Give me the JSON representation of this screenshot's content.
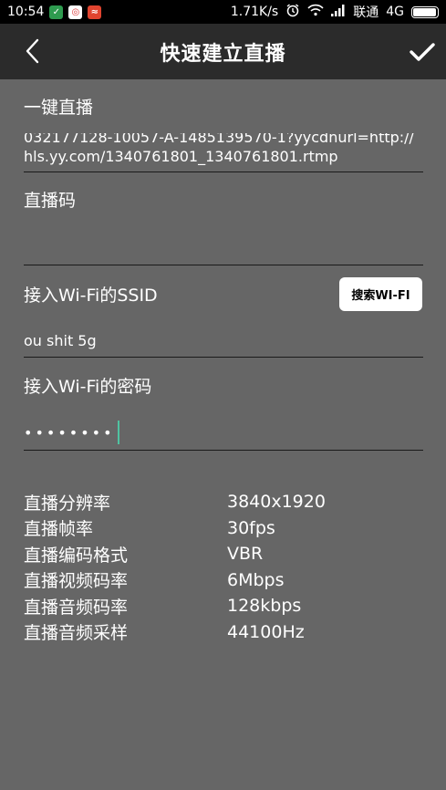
{
  "status_bar": {
    "time": "10:54",
    "net_speed": "1.71K/s",
    "carrier": "联通",
    "network": "4G",
    "battery_level": 0.95,
    "app_icons": [
      "shield-app-icon",
      "photo-app-icon",
      "message-app-icon"
    ]
  },
  "app_bar": {
    "title": "快速建立直播",
    "back_icon": "chevron-left-icon",
    "confirm_icon": "checkmark-icon"
  },
  "form": {
    "one_click_label": "一键直播",
    "stream_url": "032177128-10057-A-1485139570-1?yycdnurl=http://hls.yy.com/1340761801_1340761801.rtmp",
    "stream_code_label": "直播码",
    "stream_code_value": "",
    "wifi_ssid_label": "接入Wi-Fi的SSID",
    "search_wifi_button": "搜索WI-FI",
    "wifi_ssid_value": "ou shit 5g",
    "wifi_password_label": "接入Wi-Fi的密码",
    "wifi_password_masked": "••••••••"
  },
  "specs": [
    {
      "key": "直播分辨率",
      "value": "3840x1920"
    },
    {
      "key": "直播帧率",
      "value": "30fps"
    },
    {
      "key": "直播编码格式",
      "value": "VBR"
    },
    {
      "key": "直播视频码率",
      "value": "6Mbps"
    },
    {
      "key": "直播音频码率",
      "value": "128kbps"
    },
    {
      "key": "直播音频采样",
      "value": "44100Hz"
    }
  ],
  "colors": {
    "background": "#666666",
    "app_bar": "#2b2b2b",
    "status_bar": "#000000",
    "cursor": "#4fc3a1"
  }
}
